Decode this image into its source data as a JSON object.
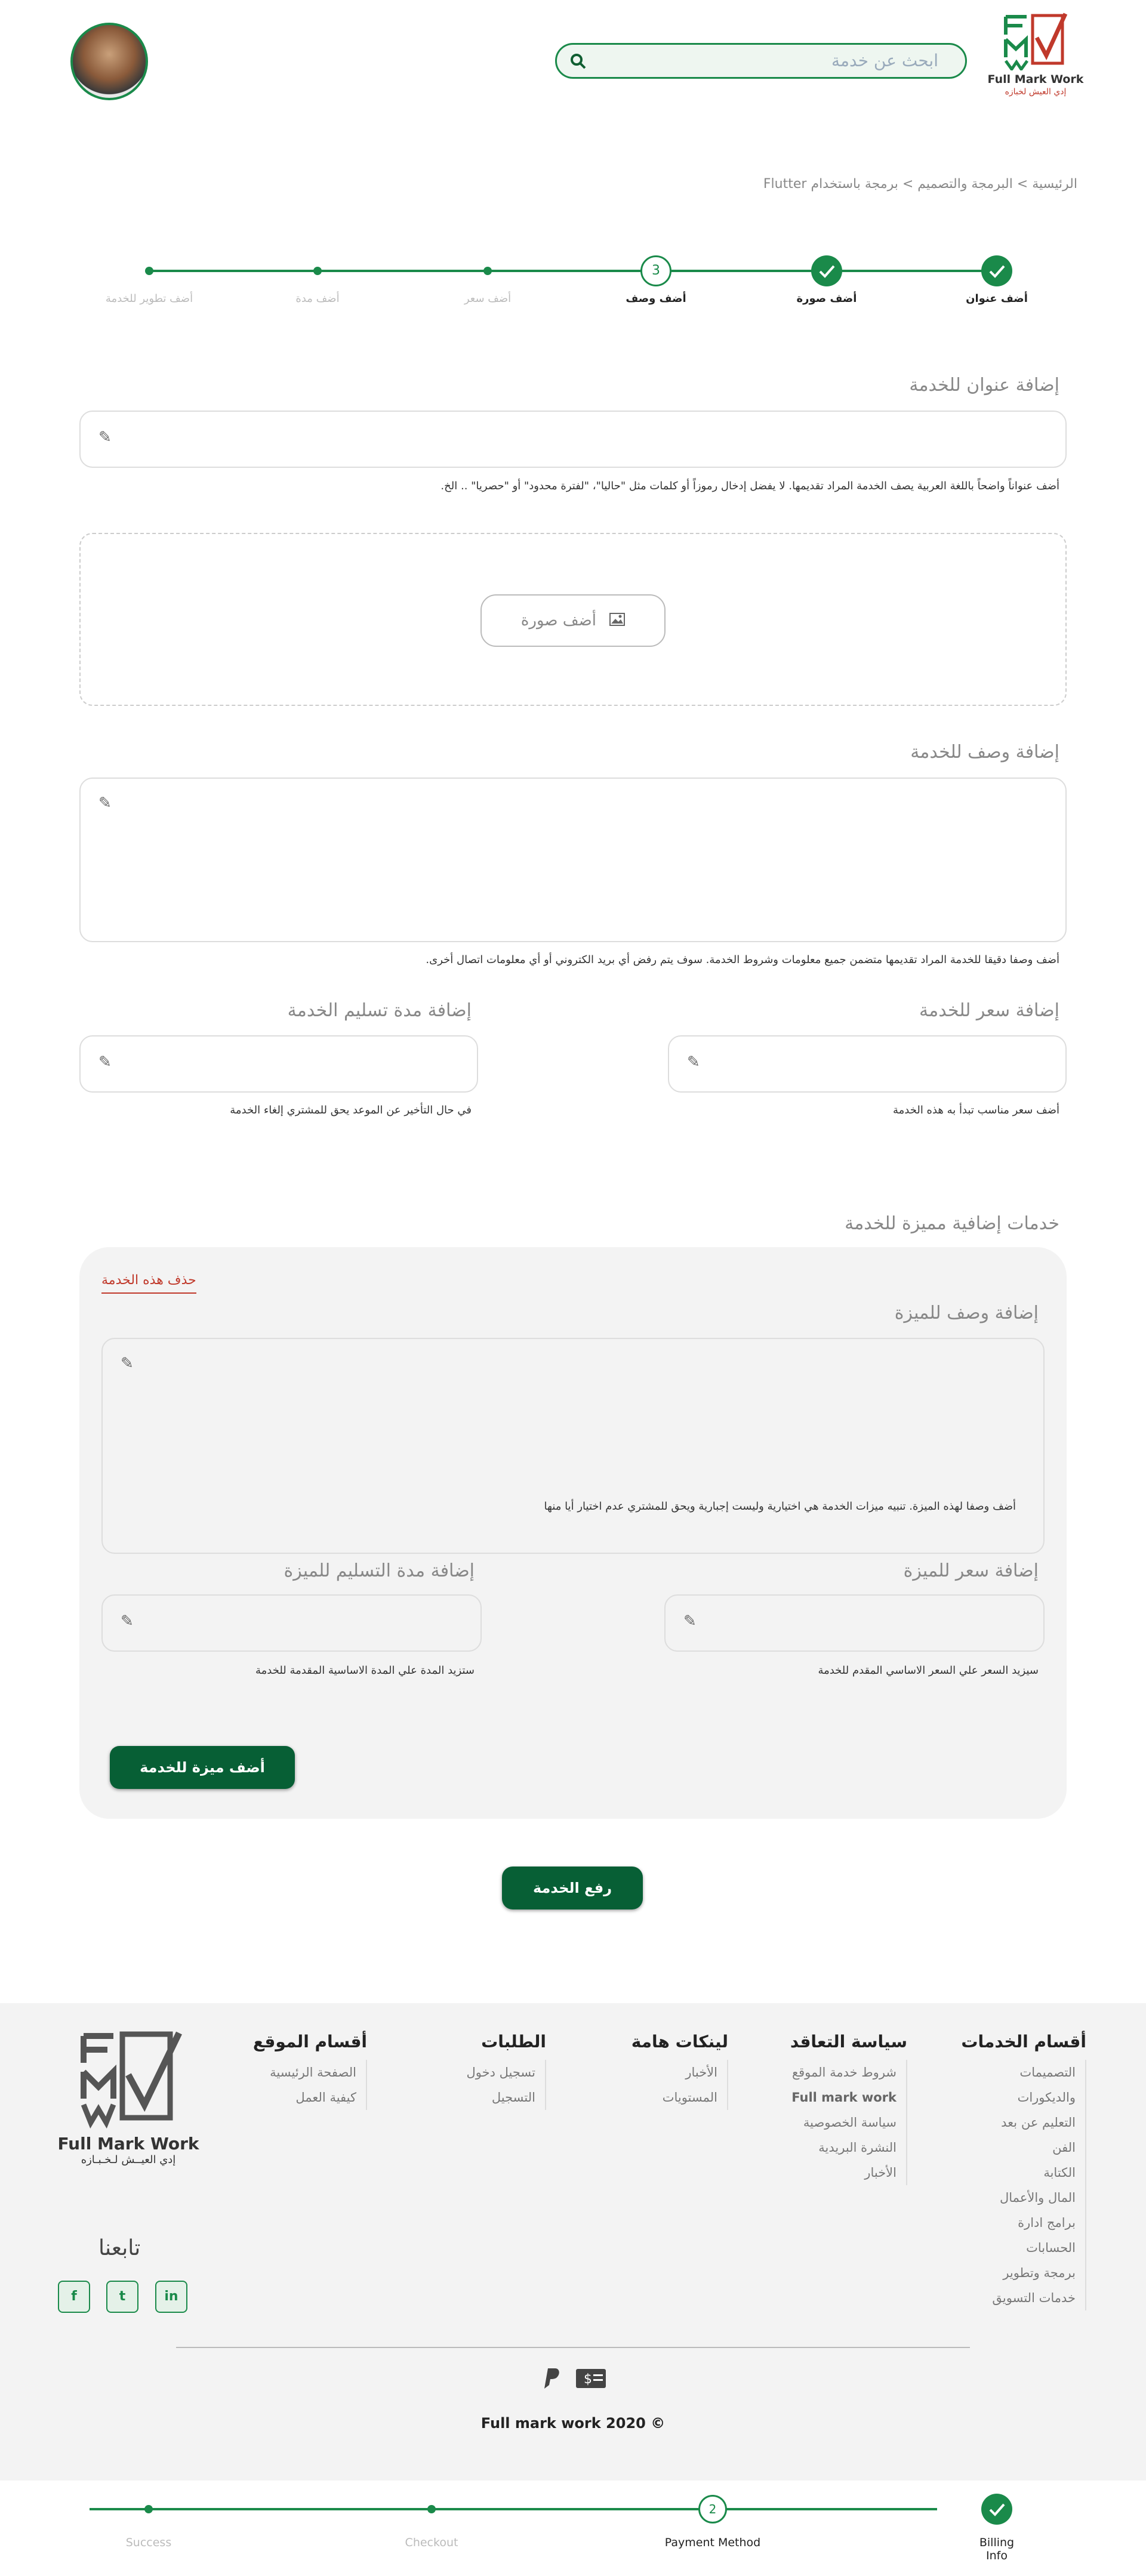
{
  "header": {
    "logo_en": "Full Mark Work",
    "logo_ar": "إدي العيش لخبازه",
    "search_placeholder": "ابحث عن خدمة"
  },
  "breadcrumb": "الرئيسية > البرمجة والتصميم > برمجة باستخدام Flutter",
  "stepper": [
    {
      "label": "أضف عنوان",
      "state": "done"
    },
    {
      "label": "أضف صورة",
      "state": "done"
    },
    {
      "label": "أضف وصف",
      "state": "current",
      "number": "3"
    },
    {
      "label": "أضف سعر",
      "state": "todo"
    },
    {
      "label": "أضف مدة",
      "state": "todo"
    },
    {
      "label": "أضف تطوير للخدمة",
      "state": "todo"
    }
  ],
  "title_section": {
    "heading": "إضافة عنوان للخدمة",
    "hint": "أضف عنواناً واضحاً باللغة العربية يصف الخدمة المراد تقديمها. لا يفضل إدخال رموزاً أو كلمات مثل \"حاليا\"، \"لفترة محدود\" أو \"حصريا\" .. الخ."
  },
  "image_section": {
    "button": "أضف صورة"
  },
  "desc_section": {
    "heading": "إضافة وصف للخدمة",
    "hint": "أضف وصفا دقيقا للخدمة المراد تقديمها متضمن جميع معلومات وشروط الخدمة. سوف يتم رفض أي بريد الكتروني أو أي معلومات اتصال أخرى."
  },
  "price_section": {
    "heading": "إضافة سعر للخدمة",
    "hint": "أضف سعر مناسب تبدأ به هذه الخدمة"
  },
  "delivery_section": {
    "heading": "إضافة مدة تسليم الخدمة",
    "hint": "في حال التأخير عن الموعد يحق للمشتري إلغاء الخدمة"
  },
  "extras": {
    "heading": "خدمات إضافية مميزة للخدمة",
    "delete": "حذف هذه الخدمة",
    "feature_desc_heading": "إضافة وصف للميزة",
    "feature_desc_text": "أضف وصفا لهذه الميزة. تنبيه ميزات الخدمة هي اختيارية وليست إجبارية ويحق للمشتري عدم اختيار أيا منها",
    "feature_price_heading": "إضافة سعر للميزة",
    "feature_price_hint": "سيزيد السعر علي السعر الاساسي المقدم للخدمة",
    "feature_delivery_heading": "إضافة مدة التسليم للميزة",
    "feature_delivery_hint": "ستزيد المدة علي المدة الاساسية المقدمة للخدمة",
    "add_feature_button": "أضف ميزة للخدمة"
  },
  "submit_button": "رفع الخدمة",
  "footer": {
    "columns": [
      {
        "heading": "أقسام الخدمات",
        "items": [
          "التصميمات",
          "والديكورات",
          "التعليم عن بعد",
          "الفن",
          "الكتابة",
          "المال والأعمال",
          "برامج ادارة",
          "الحسابات",
          "برمجة وتطوير",
          "خدمات التسويق"
        ]
      },
      {
        "heading": "سياسة التعاقد",
        "items": [
          "شروط خدمة الموقع",
          "Full mark work",
          "سياسة الخصوصية",
          "النشرة البريدية",
          "الأخبار"
        ]
      },
      {
        "heading": "لينكات هامة",
        "items": [
          "الأخبار",
          "المستويات"
        ]
      },
      {
        "heading": "الطلبات",
        "items": [
          "تسجيل دخول",
          "التسجيل"
        ]
      },
      {
        "heading": "أقسام الموقع",
        "items": [
          "الصفحة الرئيسية",
          "كيفية العمل"
        ]
      }
    ],
    "logo_en": "Full Mark Work",
    "logo_ar": "إدي العيــش لـخـبـازه",
    "follow": "تابعنا",
    "social": [
      "f",
      "t",
      "in"
    ],
    "copyright": "Full mark work 2020 ©"
  },
  "checkout_steps": [
    {
      "label": "Billing Info",
      "state": "done"
    },
    {
      "label": "Payment Method",
      "state": "current",
      "number": "2"
    },
    {
      "label": "Checkout",
      "state": "todo"
    },
    {
      "label": "Success",
      "state": "todo"
    }
  ],
  "colors": {
    "primary": "#1a8a4a",
    "dark_button": "#075f35",
    "danger": "#c0392b"
  }
}
